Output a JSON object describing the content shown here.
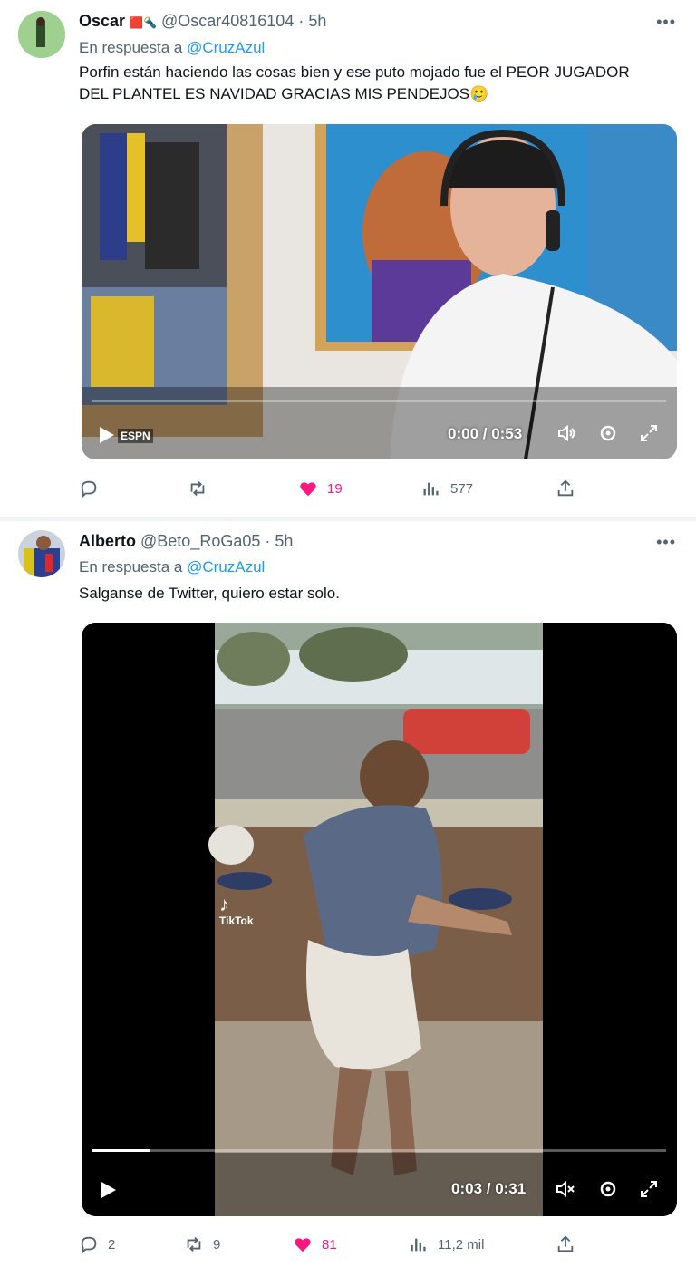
{
  "tweets": [
    {
      "name": "Oscar",
      "handle": "@Oscar40816104",
      "time_ago": "5h",
      "reply_prefix": "En respuesta a",
      "reply_to": "@CruzAzul",
      "text": "Porfin están haciendo las cosas bien y ese puto mojado fue el PEOR JUGADOR DEL PLANTEL ES NAVIDAD GRACIAS MIS PENDEJOS🥲",
      "video": {
        "time": "0:00 / 0:53",
        "progress": 0.0,
        "watermark": "ESPN"
      },
      "stats": {
        "replies": "",
        "retweets": "",
        "likes": "19",
        "views": "577"
      },
      "liked": true
    },
    {
      "name": "Alberto",
      "handle": "@Beto_RoGa05",
      "time_ago": "5h",
      "reply_prefix": "En respuesta a",
      "reply_to": "@CruzAzul",
      "text": "Salganse de Twitter, quiero estar solo.",
      "video": {
        "time": "0:03 / 0:31",
        "progress": 0.1,
        "watermark": "TikTok"
      },
      "stats": {
        "replies": "2",
        "retweets": "9",
        "likes": "81",
        "views": "11,2 mil"
      },
      "liked": true
    }
  ],
  "icons": [
    "more-icon",
    "reply-icon",
    "retweet-icon",
    "like-icon",
    "views-icon",
    "share-icon",
    "play-icon",
    "mute-icon",
    "settings-icon",
    "fullscreen-icon"
  ],
  "colors": {
    "accent": "#1d9bf0",
    "like": "#f91880",
    "muted": "#536471"
  }
}
